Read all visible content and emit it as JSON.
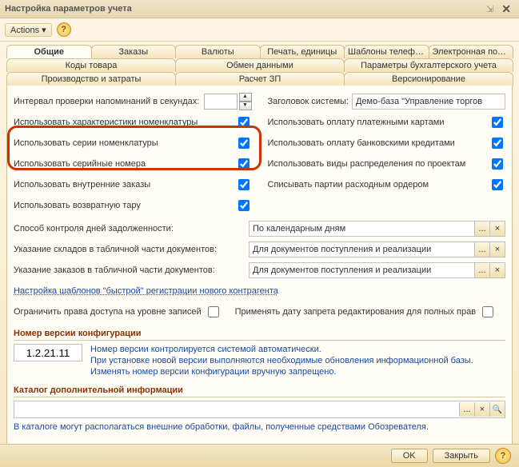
{
  "window": {
    "title": "Настройка параметров учета",
    "pin_symbol": "⇲"
  },
  "toolbar": {
    "actions_label": "Actions ▾"
  },
  "tabs": {
    "row1": [
      "Общие",
      "Заказы",
      "Валюты",
      "Печать, единицы",
      "Шаблоны телефонов",
      "Электронная почта"
    ],
    "row2": [
      "Коды товара",
      "Обмен данными",
      "Параметры бухгалтерского учета"
    ],
    "row3": [
      "Производство и затраты",
      "Расчет ЗП",
      "Версионирование"
    ],
    "active": "Общие"
  },
  "left": {
    "interval_label": "Интервал проверки напоминаний в секундах:",
    "interval_value": "",
    "use_char_label": "Использовать характеристики номенклатуры",
    "use_char_checked": true,
    "use_series_label": "Использовать серии номенклатуры",
    "use_series_checked": true,
    "use_serial_label": "Использовать серийные номера",
    "use_serial_checked": true,
    "use_internal_label": "Использовать внутренние заказы",
    "use_internal_checked": true,
    "use_return_label": "Использовать возвратную тару",
    "use_return_checked": true
  },
  "right": {
    "header_label": "Заголовок системы:",
    "header_value": "Демо-база \"Управление торгов",
    "pay_cards_label": "Использовать оплату платежными картами",
    "pay_cards_checked": true,
    "pay_credits_label": "Использовать оплату банковскими кредитами",
    "pay_credits_checked": true,
    "distrib_label": "Использовать виды распределения по проектам",
    "distrib_checked": true,
    "writeoff_label": "Списывать партии расходным ордером",
    "writeoff_checked": true
  },
  "wide": {
    "debt_label": "Способ контроля дней задолженности:",
    "debt_value": "По календарным дням",
    "stores_label": "Указание складов в табличной части документов:",
    "stores_value": "Для документов поступления и реализации",
    "orders_label": "Указание заказов в табличной части документов:",
    "orders_value": "Для документов поступления и реализации",
    "quick_link": "Настройка шаблонов \"быстрой\" регистрации нового контрагента",
    "restrict_label": "Ограничить права доступа на уровне записей",
    "restrict_checked": false,
    "apply_date_label": "Применять дату запрета редактирования для полных прав",
    "apply_date_checked": false
  },
  "version": {
    "section": "Номер версии конфигурации",
    "value": "1.2.21.11",
    "note1": "Номер версии контролируется системой автоматически.",
    "note2": "При установке новой версии выполняются необходимые обновления информационной базы.",
    "note3": "Изменять номер версии конфигурации вручную запрещено."
  },
  "catalog": {
    "section": "Каталог дополнительной информации",
    "value": "",
    "note": "В каталоге могут располагаться внешние обработки, файлы, полученные средствами Обозревателя."
  },
  "footer": {
    "ok": "OK",
    "close": "Закрыть"
  },
  "btns": {
    "ellipsis": "...",
    "clear": "×"
  }
}
